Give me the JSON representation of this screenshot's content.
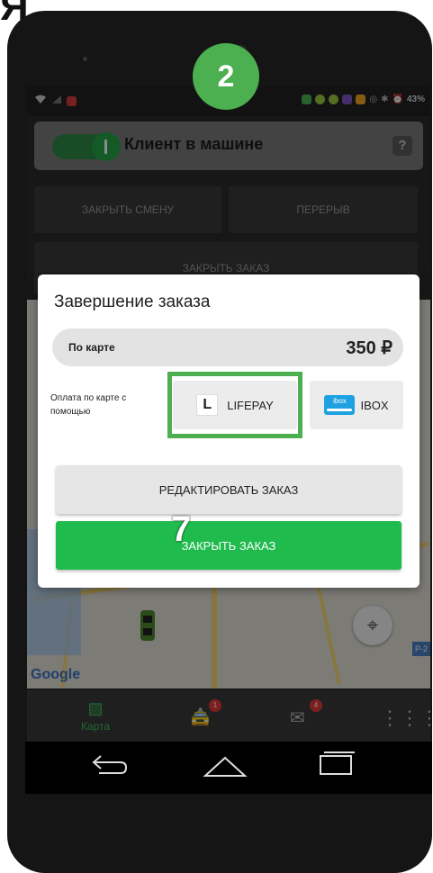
{
  "corner_text": "Я",
  "annotations": {
    "step_badge": "2",
    "step_number": "7"
  },
  "status_bar": {
    "battery": "43%"
  },
  "client_bar": {
    "label": "Клиент в машине"
  },
  "top_buttons": {
    "close_shift": "ЗАКРЫТЬ СМЕНУ",
    "break": "ПЕРЕРЫВ",
    "close_order": "ЗАКРЫТЬ ЗАКАЗ"
  },
  "map": {
    "provider_label": "Google",
    "road_tag": "Р-2"
  },
  "bottom_nav": {
    "items": [
      {
        "label": "Карта",
        "icon": "map-icon"
      },
      {
        "label": "",
        "icon": "car-icon",
        "badge": "1"
      },
      {
        "label": "",
        "icon": "mail-icon",
        "badge": "4"
      },
      {
        "label": "",
        "icon": "grid-icon"
      }
    ]
  },
  "modal": {
    "title": "Завершение заказа",
    "payment_label": "По карте",
    "amount": "350 ₽",
    "help_text": "Оплата по карте с помощью",
    "methods": [
      {
        "label": "LIFEPAY",
        "logo": "L",
        "selected": true
      },
      {
        "label": "IBOX",
        "logo": "ibox",
        "selected": false
      }
    ],
    "edit_button": "РЕДАКТИРОВАТЬ ЗАКАЗ",
    "close_button": "ЗАКРЫТЬ ЗАКАЗ"
  },
  "colors": {
    "accent": "#1fbb4d",
    "highlight": "#4caf50",
    "ibox": "#1ea1e0"
  }
}
